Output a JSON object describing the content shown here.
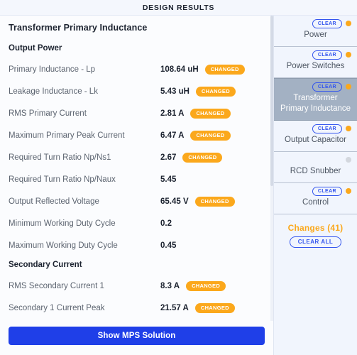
{
  "header": {
    "title": "DESIGN RESULTS"
  },
  "main": {
    "section_title": "Transformer Primary Inductance",
    "groups": [
      {
        "title": "Output Power",
        "rows": [
          {
            "label": "Primary Inductance - Lp",
            "value": "108.64 uH",
            "badge": "CHANGED"
          },
          {
            "label": "Leakage Inductance - Lk",
            "value": "5.43 uH",
            "badge": "CHANGED"
          },
          {
            "label": "RMS Primary Current",
            "value": "2.81 A",
            "badge": "CHANGED"
          },
          {
            "label": "Maximum Primary Peak Current",
            "value": "6.47 A",
            "badge": "CHANGED"
          },
          {
            "label": "Required Turn Ratio Np/Ns1",
            "value": "2.67",
            "badge": "CHANGED"
          },
          {
            "label": "Required Turn Ratio Np/Naux",
            "value": "5.45",
            "badge": ""
          },
          {
            "label": "Output Reflected Voltage",
            "value": "65.45 V",
            "badge": "CHANGED"
          },
          {
            "label": "Minimum Working Duty Cycle",
            "value": "0.2",
            "badge": ""
          },
          {
            "label": "Maximum Working Duty Cycle",
            "value": "0.45",
            "badge": ""
          }
        ]
      },
      {
        "title": "Secondary Current",
        "rows": [
          {
            "label": "RMS Secondary Current 1",
            "value": "8.3 A",
            "badge": "CHANGED"
          },
          {
            "label": "Secondary 1 Current Peak",
            "value": "21.57 A",
            "badge": "CHANGED"
          }
        ]
      }
    ],
    "show_solution_label": "Show MPS Solution"
  },
  "sidebar": {
    "items": [
      {
        "label": "Power",
        "clear_label": "CLEAR",
        "has_clear": true,
        "dot": "orange",
        "selected": false
      },
      {
        "label": "Power Switches",
        "clear_label": "CLEAR",
        "has_clear": true,
        "dot": "orange",
        "selected": false
      },
      {
        "label": "Transformer Primary Inductance",
        "clear_label": "CLEAR",
        "has_clear": true,
        "dot": "orange",
        "selected": true
      },
      {
        "label": "Output Capacitor",
        "clear_label": "CLEAR",
        "has_clear": true,
        "dot": "orange",
        "selected": false
      },
      {
        "label": "RCD Snubber",
        "clear_label": "",
        "has_clear": false,
        "dot": "gray",
        "selected": false
      },
      {
        "label": "Control",
        "clear_label": "CLEAR",
        "has_clear": true,
        "dot": "orange",
        "selected": false
      }
    ],
    "changes": {
      "title": "Changes (41)",
      "clear_all_label": "CLEAR ALL"
    }
  },
  "colors": {
    "accent_blue": "#1f3fe8",
    "badge_orange": "#fba81c",
    "selected_gray": "#a3b1c3",
    "page_bg": "#f4f7fd",
    "panel_bg": "#fbfcfe"
  }
}
